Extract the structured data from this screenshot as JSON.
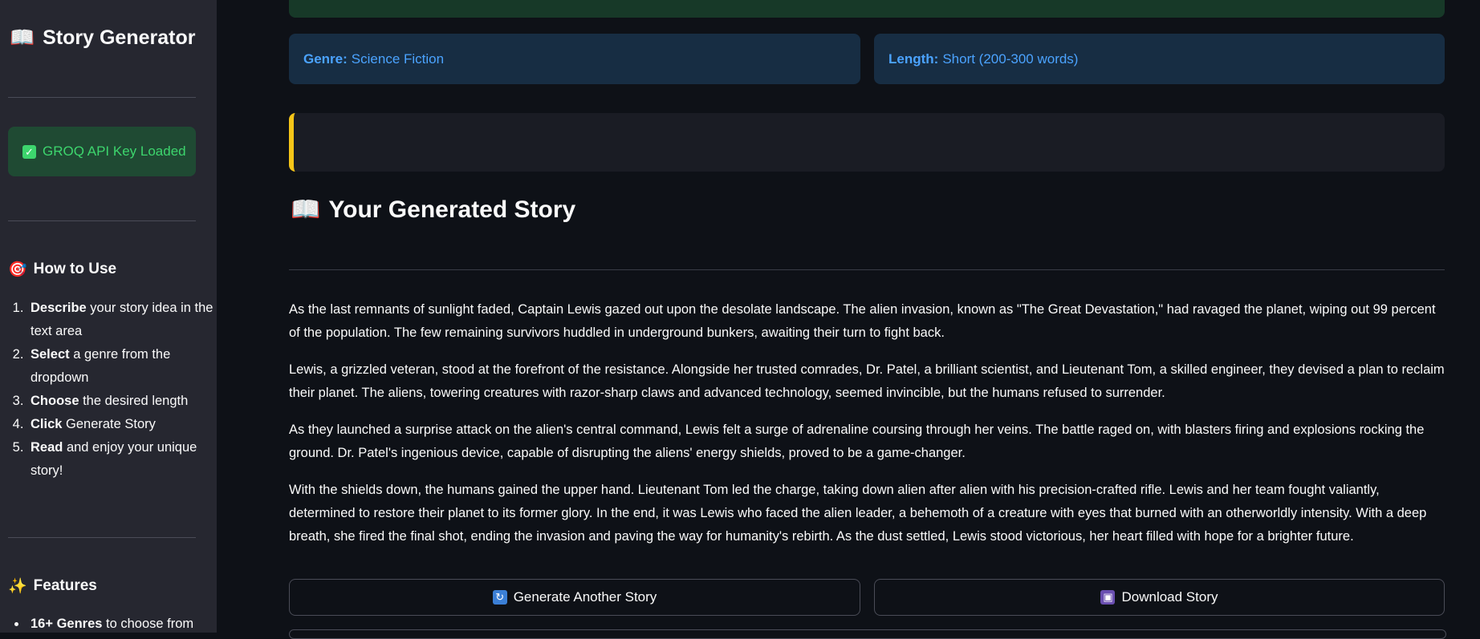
{
  "sidebar": {
    "title_icon": "📖",
    "title": "Story Generator",
    "api_status": "GROQ API Key Loaded",
    "how_to_use_icon": "🎯",
    "how_to_use_title": "How to Use",
    "steps": [
      {
        "bold": "Describe",
        "rest": " your story idea in the text area"
      },
      {
        "bold": "Select",
        "rest": " a genre from the dropdown"
      },
      {
        "bold": "Choose",
        "rest": " the desired length"
      },
      {
        "bold": "Click",
        "rest": " Generate Story"
      },
      {
        "bold": "Read",
        "rest": " and enjoy your unique story!"
      }
    ],
    "features_icon": "✨",
    "features_title": "Features",
    "features": [
      {
        "bold": "16+ Genres",
        "rest": " to choose from"
      }
    ]
  },
  "main": {
    "genre_label": "Genre:",
    "genre_value": "Science Fiction",
    "length_label": "Length:",
    "length_value": "Short (200-300 words)",
    "story_icon": "📖",
    "story_title": "Your Generated Story",
    "paragraphs": [
      "As the last remnants of sunlight faded, Captain Lewis gazed out upon the desolate landscape. The alien invasion, known as \"The Great Devastation,\" had ravaged the planet, wiping out 99 percent of the population. The few remaining survivors huddled in underground bunkers, awaiting their turn to fight back.",
      "Lewis, a grizzled veteran, stood at the forefront of the resistance. Alongside her trusted comrades, Dr. Patel, a brilliant scientist, and Lieutenant Tom, a skilled engineer, they devised a plan to reclaim their planet. The aliens, towering creatures with razor-sharp claws and advanced technology, seemed invincible, but the humans refused to surrender.",
      "As they launched a surprise attack on the alien's central command, Lewis felt a surge of adrenaline coursing through her veins. The battle raged on, with blasters firing and explosions rocking the ground. Dr. Patel's ingenious device, capable of disrupting the aliens' energy shields, proved to be a game-changer.",
      "With the shields down, the humans gained the upper hand. Lieutenant Tom led the charge, taking down alien after alien with his precision-crafted rifle. Lewis and her team fought valiantly, determined to restore their planet to its former glory. In the end, it was Lewis who faced the alien leader, a behemoth of a creature with eyes that burned with an otherworldly intensity. With a deep breath, she fired the final shot, ending the invasion and paving the way for humanity's rebirth. As the dust settled, Lewis stood victorious, her heart filled with hope for a brighter future."
    ],
    "generate_another_label": "Generate Another Story",
    "download_label": "Download Story"
  },
  "colors": {
    "background": "#0e1117",
    "sidebar": "#262730",
    "success_bg": "#1f4a33",
    "success_text": "#3dd56d",
    "info_bg": "#172d43",
    "info_text": "#4ba3ff",
    "warning_accent": "#f5c518"
  },
  "icons": {
    "success": "check-box-icon",
    "generate_another": "refresh-icon",
    "download": "floppy-disk-icon"
  }
}
